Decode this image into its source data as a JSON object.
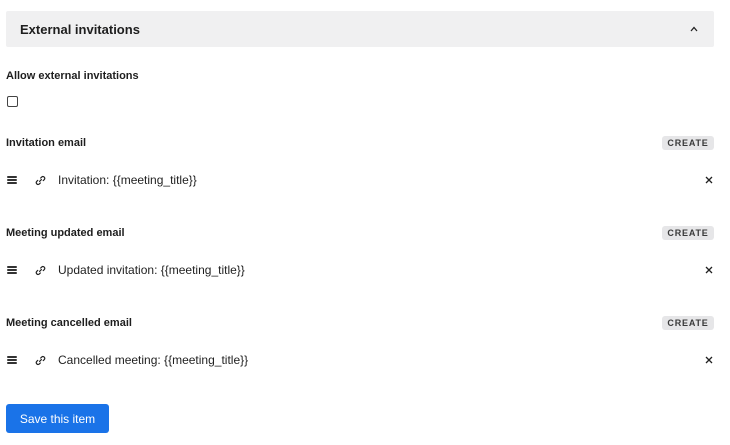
{
  "panel": {
    "title": "External invitations",
    "toggle_icon": "chevron-up-icon"
  },
  "allow": {
    "label": "Allow external invitations",
    "checked": false
  },
  "sections": [
    {
      "label": "Invitation email",
      "create_label": "CREATE",
      "item_text": "Invitation: {{meeting_title}}"
    },
    {
      "label": "Meeting updated email",
      "create_label": "CREATE",
      "item_text": "Updated invitation: {{meeting_title}}"
    },
    {
      "label": "Meeting cancelled email",
      "create_label": "CREATE",
      "item_text": "Cancelled meeting: {{meeting_title}}"
    }
  ],
  "save_label": "Save this item",
  "colors": {
    "accent": "#1a73e8",
    "panel_bg": "#f0f0f1",
    "create_bg": "#e6e6e8"
  }
}
